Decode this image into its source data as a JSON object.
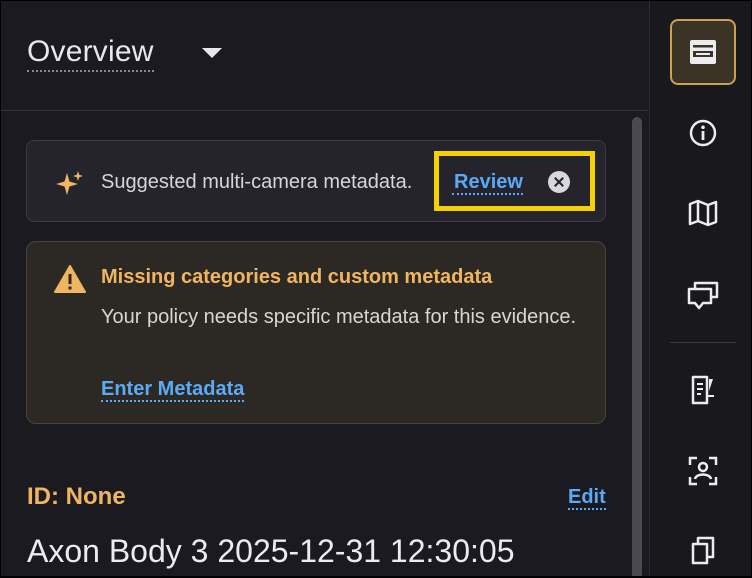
{
  "header": {
    "title": "Overview"
  },
  "suggestion": {
    "text": "Suggested multi-camera metadata.",
    "review_label": "Review"
  },
  "warning": {
    "title": "Missing categories and custom metadata",
    "body": "Your policy needs specific metadata for this evidence.",
    "link_label": "Enter Metadata"
  },
  "record": {
    "id_label": "ID: None",
    "edit_label": "Edit",
    "title": "Axon Body 3 2025-12-31 12:30:05"
  },
  "rail": {
    "items": [
      {
        "icon": "overview-panel-icon",
        "active": true
      },
      {
        "icon": "info-icon",
        "active": false
      },
      {
        "icon": "map-icon",
        "active": false
      },
      {
        "icon": "comments-icon",
        "active": false
      },
      {
        "icon": "document-edit-icon",
        "active": false
      },
      {
        "icon": "person-scan-icon",
        "active": false
      },
      {
        "icon": "copies-icon",
        "active": false
      }
    ]
  },
  "colors": {
    "accent_blue": "#5aaaf5",
    "warning_amber": "#f0b560",
    "highlight_yellow": "#f5d100",
    "background": "#1b1a20"
  }
}
